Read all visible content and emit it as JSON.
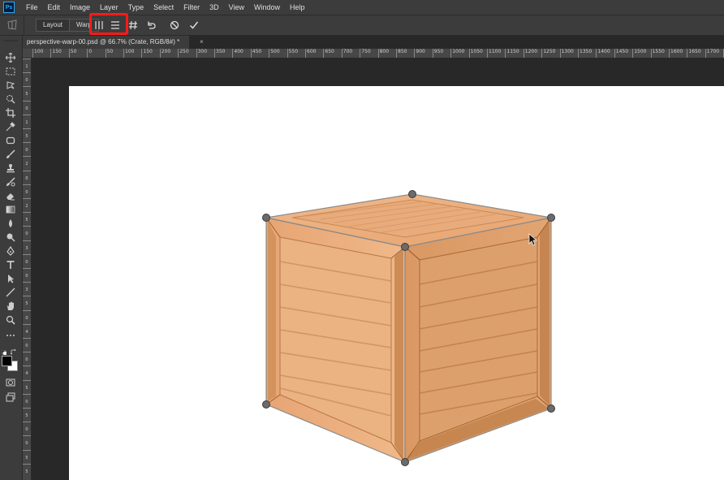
{
  "app": {
    "logo": "Ps"
  },
  "menu": [
    "File",
    "Edit",
    "Image",
    "Layer",
    "Type",
    "Select",
    "Filter",
    "3D",
    "View",
    "Window",
    "Help"
  ],
  "options_bar": {
    "mode_layout": "Layout",
    "mode_warp": "Warp",
    "icons": [
      "straighten-vertical-icon",
      "straighten-horizontal-icon",
      "grid-icon",
      "undo-icon",
      "cancel-icon",
      "commit-icon"
    ],
    "highlight_color": "#ff1a1a"
  },
  "document_tab": {
    "title": "perspective-warp-00.psd @ 66.7% (Crate, RGB/8#) *",
    "close": "×"
  },
  "ruler": {
    "h_labels": [
      "100",
      "150",
      "50",
      "0",
      "50",
      "100",
      "150",
      "200",
      "250",
      "300",
      "350",
      "400",
      "450",
      "500",
      "550",
      "600",
      "650",
      "700",
      "750",
      "800",
      "850",
      "900",
      "950",
      "1000",
      "1050",
      "1100",
      "1150",
      "1200",
      "1250",
      "1300",
      "1350",
      "1400",
      "1450",
      "1500",
      "1550",
      "1600",
      "1650",
      "1700",
      "1750"
    ],
    "v_labels": [
      "1",
      "0",
      "5",
      "0",
      "1",
      "5",
      "0",
      "2",
      "0",
      "0",
      "2",
      "5",
      "0",
      "3",
      "0",
      "0",
      "3",
      "5",
      "0",
      "4",
      "0",
      "0",
      "4",
      "5",
      "0",
      "5",
      "0",
      "0",
      "5",
      "5",
      "0"
    ]
  },
  "tools": [
    "move-icon",
    "marquee-icon",
    "lasso-icon",
    "quick-select-icon",
    "crop-icon",
    "eyedropper-icon",
    "frame-icon",
    "brush-icon",
    "stamp-icon",
    "history-brush-icon",
    "eraser-icon",
    "gradient-icon",
    "blur-icon",
    "dodge-icon",
    "pen-icon",
    "type-icon",
    "path-select-icon",
    "line-icon",
    "hand-icon",
    "zoom-icon",
    "more-icon"
  ],
  "colors": {
    "foreground": "#000000",
    "background": "#ffffff",
    "wood_light": "#e8a878",
    "wood_mid": "#d48c5a",
    "wood_dark": "#b06a3a",
    "handle": "#6b6b6b"
  }
}
